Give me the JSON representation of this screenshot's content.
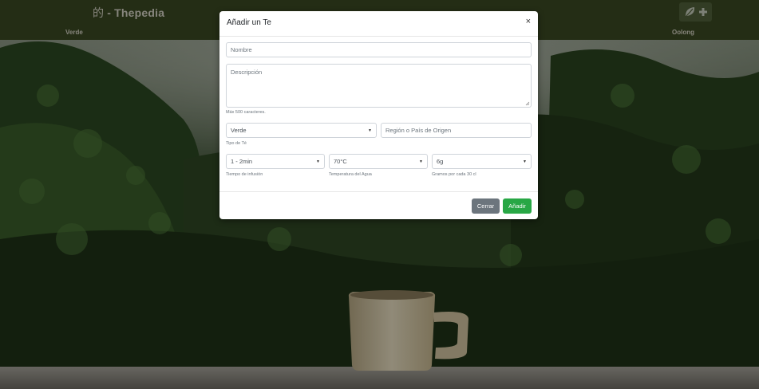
{
  "header": {
    "brand_glyph": "的",
    "brand_text": "- Thepedia",
    "nav": [
      "Verde",
      "Oolong"
    ],
    "add_button_icon": "leaf-plus-icon"
  },
  "modal": {
    "title": "Añadir un Te",
    "close_glyph": "×",
    "name_placeholder": "Nombre",
    "description_placeholder": "Descripción",
    "description_help": "Máx 500 caracteres.",
    "tea_type_value": "Verde",
    "tea_type_help": "Tipo de Té",
    "origin_placeholder": "Región o País de Origen",
    "infusion_value": "1 - 2min",
    "infusion_help": "Tiempo de infusión",
    "temperature_value": "70°C",
    "temperature_help": "Temperatura del Agua",
    "grams_value": "6g",
    "grams_help": "Gramos por cada 30 cl",
    "close_label": "Cerrar",
    "add_label": "Añadir"
  },
  "colors": {
    "header_bg": "#3b4a22",
    "add_button_bg": "#28a745",
    "close_button_bg": "#6c757d"
  }
}
